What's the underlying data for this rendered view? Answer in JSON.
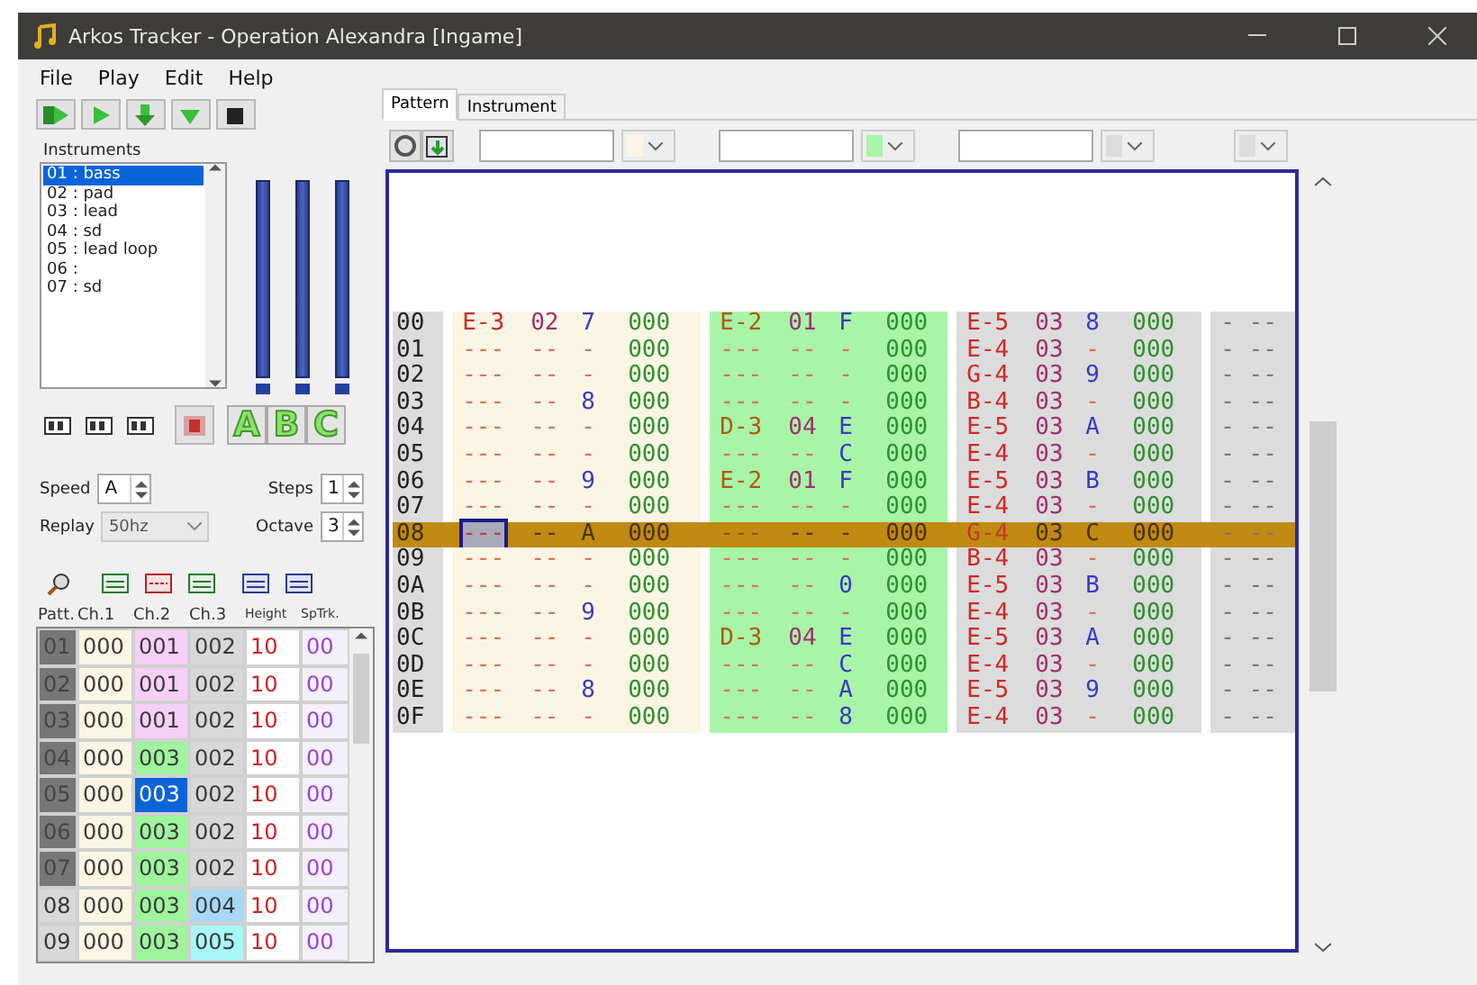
{
  "window": {
    "title": "Arkos Tracker - Operation Alexandra [Ingame]"
  },
  "menu": [
    "File",
    "Play",
    "Edit",
    "Help"
  ],
  "instruments": {
    "label": "Instruments",
    "items": [
      {
        "label": "01 : bass",
        "selected": true
      },
      {
        "label": "02 : pad",
        "selected": false
      },
      {
        "label": "03 : lead",
        "selected": false
      },
      {
        "label": "04 : sd",
        "selected": false
      },
      {
        "label": "05 : lead loop",
        "selected": false
      },
      {
        "label": "06 :",
        "selected": false
      },
      {
        "label": "07 : sd",
        "selected": false
      }
    ]
  },
  "meters": [
    {
      "level": 1
    },
    {
      "level": 1
    },
    {
      "level": 1
    }
  ],
  "channel_toggles": [
    {
      "label": "A",
      "on": true
    },
    {
      "label": "B",
      "on": true
    },
    {
      "label": "C",
      "on": true
    }
  ],
  "speed": {
    "label": "Speed",
    "value": "A"
  },
  "steps": {
    "label": "Steps",
    "value": "1"
  },
  "replay": {
    "label": "Replay",
    "value": "50hz"
  },
  "octave": {
    "label": "Octave",
    "value": "3"
  },
  "pattern_list": {
    "columns": [
      "Patt.",
      "Ch.1",
      "Ch.2",
      "Ch.3",
      "Height",
      "SpTrk."
    ],
    "rows": [
      {
        "cells": [
          {
            "kind": "patt",
            "text": "01",
            "played": true
          },
          {
            "kind": "track",
            "text": "000",
            "color": "#fbf6e4",
            "selected": false
          },
          {
            "kind": "track",
            "text": "001",
            "color": "#f6d0f6",
            "selected": false
          },
          {
            "kind": "track",
            "text": "002",
            "color": "#d8d8d8",
            "selected": false
          },
          {
            "kind": "height",
            "text": "10"
          },
          {
            "kind": "sptrk",
            "text": "00"
          }
        ]
      },
      {
        "cells": [
          {
            "kind": "patt",
            "text": "02",
            "played": true
          },
          {
            "kind": "track",
            "text": "000",
            "color": "#fbf6e4",
            "selected": false
          },
          {
            "kind": "track",
            "text": "001",
            "color": "#f6d0f6",
            "selected": false
          },
          {
            "kind": "track",
            "text": "002",
            "color": "#d8d8d8",
            "selected": false
          },
          {
            "kind": "height",
            "text": "10"
          },
          {
            "kind": "sptrk",
            "text": "00"
          }
        ]
      },
      {
        "cells": [
          {
            "kind": "patt",
            "text": "03",
            "played": true
          },
          {
            "kind": "track",
            "text": "000",
            "color": "#fbf6e4",
            "selected": false
          },
          {
            "kind": "track",
            "text": "001",
            "color": "#f6d0f6",
            "selected": false
          },
          {
            "kind": "track",
            "text": "002",
            "color": "#d8d8d8",
            "selected": false
          },
          {
            "kind": "height",
            "text": "10"
          },
          {
            "kind": "sptrk",
            "text": "00"
          }
        ]
      },
      {
        "cells": [
          {
            "kind": "patt",
            "text": "04",
            "played": true
          },
          {
            "kind": "track",
            "text": "000",
            "color": "#fbf6e4",
            "selected": false
          },
          {
            "kind": "track",
            "text": "003",
            "color": "#9ef59e",
            "selected": false
          },
          {
            "kind": "track",
            "text": "002",
            "color": "#d8d8d8",
            "selected": false
          },
          {
            "kind": "height",
            "text": "10"
          },
          {
            "kind": "sptrk",
            "text": "00"
          }
        ]
      },
      {
        "cells": [
          {
            "kind": "patt",
            "text": "05",
            "played": true
          },
          {
            "kind": "track",
            "text": "000",
            "color": "#fbf6e4",
            "selected": false
          },
          {
            "kind": "track",
            "text": "003",
            "selected": true
          },
          {
            "kind": "track",
            "text": "002",
            "color": "#d8d8d8",
            "selected": false
          },
          {
            "kind": "height",
            "text": "10"
          },
          {
            "kind": "sptrk",
            "text": "00"
          }
        ]
      },
      {
        "cells": [
          {
            "kind": "patt",
            "text": "06",
            "played": true
          },
          {
            "kind": "track",
            "text": "000",
            "color": "#fbf6e4",
            "selected": false
          },
          {
            "kind": "track",
            "text": "003",
            "color": "#9ef59e",
            "selected": false
          },
          {
            "kind": "track",
            "text": "002",
            "color": "#d8d8d8",
            "selected": false
          },
          {
            "kind": "height",
            "text": "10"
          },
          {
            "kind": "sptrk",
            "text": "00"
          }
        ]
      },
      {
        "cells": [
          {
            "kind": "patt",
            "text": "07",
            "played": true
          },
          {
            "kind": "track",
            "text": "000",
            "color": "#fbf6e4",
            "selected": false
          },
          {
            "kind": "track",
            "text": "003",
            "color": "#9ef59e",
            "selected": false
          },
          {
            "kind": "track",
            "text": "002",
            "color": "#d8d8d8",
            "selected": false
          },
          {
            "kind": "height",
            "text": "10"
          },
          {
            "kind": "sptrk",
            "text": "00"
          }
        ]
      },
      {
        "cells": [
          {
            "kind": "patt",
            "text": "08",
            "played": false
          },
          {
            "kind": "track",
            "text": "000",
            "color": "#fbf6e4",
            "selected": false
          },
          {
            "kind": "track",
            "text": "003",
            "color": "#9ef59e",
            "selected": false
          },
          {
            "kind": "track",
            "text": "004",
            "color": "#a8d8f8",
            "selected": false
          },
          {
            "kind": "height",
            "text": "10"
          },
          {
            "kind": "sptrk",
            "text": "00"
          }
        ]
      },
      {
        "cells": [
          {
            "kind": "patt",
            "text": "09",
            "played": false
          },
          {
            "kind": "track",
            "text": "000",
            "color": "#fbf6e4",
            "selected": false
          },
          {
            "kind": "track",
            "text": "003",
            "color": "#9ef59e",
            "selected": false
          },
          {
            "kind": "track",
            "text": "005",
            "color": "#a8f8f8",
            "selected": false
          },
          {
            "kind": "height",
            "text": "10"
          },
          {
            "kind": "sptrk",
            "text": "00"
          }
        ]
      }
    ]
  },
  "tabs": [
    {
      "label": "Pattern",
      "selected": true
    },
    {
      "label": "Instrument",
      "selected": false
    }
  ],
  "channels": [
    {
      "kind": "named",
      "color": "#fbf6e4"
    },
    {
      "kind": "named",
      "color": "#a8f5a8"
    },
    {
      "kind": "named",
      "color": "#dcdcdc"
    },
    {
      "kind": "plain",
      "color": "#dcdcdc"
    }
  ],
  "pattern": {
    "rows": [
      {
        "line": "00",
        "selected": false,
        "cursor": false,
        "tracks": [
          [
            "E-3",
            "02",
            "7",
            "000"
          ],
          [
            "E-2",
            "01",
            "F",
            "000"
          ],
          [
            "E-5",
            "03",
            "8",
            "000"
          ]
        ],
        "extra": "- --"
      },
      {
        "line": "01",
        "selected": false,
        "cursor": false,
        "tracks": [
          [
            "---",
            "--",
            "-",
            "000"
          ],
          [
            "---",
            "--",
            "-",
            "000"
          ],
          [
            "E-4",
            "03",
            "-",
            "000"
          ]
        ],
        "extra": "- --"
      },
      {
        "line": "02",
        "selected": false,
        "cursor": false,
        "tracks": [
          [
            "---",
            "--",
            "-",
            "000"
          ],
          [
            "---",
            "--",
            "-",
            "000"
          ],
          [
            "G-4",
            "03",
            "9",
            "000"
          ]
        ],
        "extra": "- --"
      },
      {
        "line": "03",
        "selected": false,
        "cursor": false,
        "tracks": [
          [
            "---",
            "--",
            "8",
            "000"
          ],
          [
            "---",
            "--",
            "-",
            "000"
          ],
          [
            "B-4",
            "03",
            "-",
            "000"
          ]
        ],
        "extra": "- --"
      },
      {
        "line": "04",
        "selected": false,
        "cursor": false,
        "tracks": [
          [
            "---",
            "--",
            "-",
            "000"
          ],
          [
            "D-3",
            "04",
            "E",
            "000"
          ],
          [
            "E-5",
            "03",
            "A",
            "000"
          ]
        ],
        "extra": "- --"
      },
      {
        "line": "05",
        "selected": false,
        "cursor": false,
        "tracks": [
          [
            "---",
            "--",
            "-",
            "000"
          ],
          [
            "---",
            "--",
            "C",
            "000"
          ],
          [
            "E-4",
            "03",
            "-",
            "000"
          ]
        ],
        "extra": "- --"
      },
      {
        "line": "06",
        "selected": false,
        "cursor": false,
        "tracks": [
          [
            "---",
            "--",
            "9",
            "000"
          ],
          [
            "E-2",
            "01",
            "F",
            "000"
          ],
          [
            "E-5",
            "03",
            "B",
            "000"
          ]
        ],
        "extra": "- --"
      },
      {
        "line": "07",
        "selected": false,
        "cursor": false,
        "tracks": [
          [
            "---",
            "--",
            "-",
            "000"
          ],
          [
            "---",
            "--",
            "-",
            "000"
          ],
          [
            "E-4",
            "03",
            "-",
            "000"
          ]
        ],
        "extra": "- --"
      },
      {
        "line": "08",
        "selected": true,
        "cursor": true,
        "tracks": [
          [
            "---",
            "--",
            "A",
            "000"
          ],
          [
            "---",
            "--",
            "-",
            "000"
          ],
          [
            "G-4",
            "03",
            "C",
            "000"
          ]
        ],
        "extra": "- --"
      },
      {
        "line": "09",
        "selected": false,
        "cursor": false,
        "tracks": [
          [
            "---",
            "--",
            "-",
            "000"
          ],
          [
            "---",
            "--",
            "-",
            "000"
          ],
          [
            "B-4",
            "03",
            "-",
            "000"
          ]
        ],
        "extra": "- --"
      },
      {
        "line": "0A",
        "selected": false,
        "cursor": false,
        "tracks": [
          [
            "---",
            "--",
            "-",
            "000"
          ],
          [
            "---",
            "--",
            "0",
            "000"
          ],
          [
            "E-5",
            "03",
            "B",
            "000"
          ]
        ],
        "extra": "- --"
      },
      {
        "line": "0B",
        "selected": false,
        "cursor": false,
        "tracks": [
          [
            "---",
            "--",
            "9",
            "000"
          ],
          [
            "---",
            "--",
            "-",
            "000"
          ],
          [
            "E-4",
            "03",
            "-",
            "000"
          ]
        ],
        "extra": "- --"
      },
      {
        "line": "0C",
        "selected": false,
        "cursor": false,
        "tracks": [
          [
            "---",
            "--",
            "-",
            "000"
          ],
          [
            "D-3",
            "04",
            "E",
            "000"
          ],
          [
            "E-5",
            "03",
            "A",
            "000"
          ]
        ],
        "extra": "- --"
      },
      {
        "line": "0D",
        "selected": false,
        "cursor": false,
        "tracks": [
          [
            "---",
            "--",
            "-",
            "000"
          ],
          [
            "---",
            "--",
            "C",
            "000"
          ],
          [
            "E-4",
            "03",
            "-",
            "000"
          ]
        ],
        "extra": "- --"
      },
      {
        "line": "0E",
        "selected": false,
        "cursor": false,
        "tracks": [
          [
            "---",
            "--",
            "8",
            "000"
          ],
          [
            "---",
            "--",
            "A",
            "000"
          ],
          [
            "E-5",
            "03",
            "9",
            "000"
          ]
        ],
        "extra": "- --"
      },
      {
        "line": "0F",
        "selected": false,
        "cursor": false,
        "tracks": [
          [
            "---",
            "--",
            "-",
            "000"
          ],
          [
            "---",
            "--",
            "8",
            "000"
          ],
          [
            "E-4",
            "03",
            "-",
            "000"
          ]
        ],
        "extra": "- --"
      }
    ]
  }
}
